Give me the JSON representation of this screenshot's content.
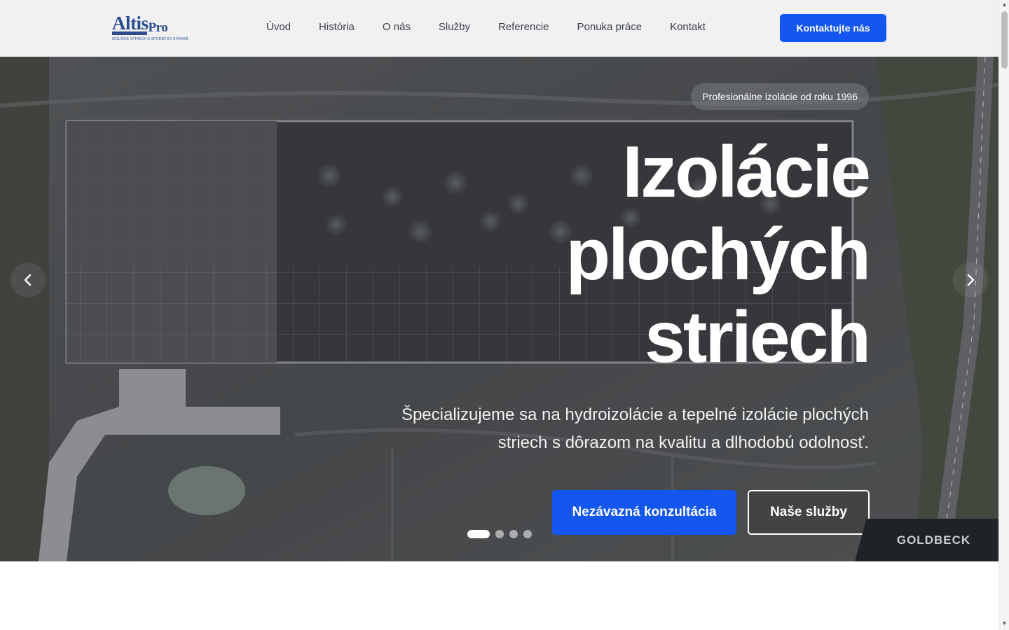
{
  "brand": {
    "logo_main": "AltisPro",
    "logo_main_a": "Altis",
    "logo_main_b": "Pro",
    "logo_tagline": "IZOLÁCIE STRIECH A SPODNÝCH STAVIEB"
  },
  "nav": {
    "items": [
      {
        "label": "Úvod"
      },
      {
        "label": "História"
      },
      {
        "label": "O nás"
      },
      {
        "label": "Služby"
      },
      {
        "label": "Referencie"
      },
      {
        "label": "Ponuka práce"
      },
      {
        "label": "Kontakt"
      }
    ],
    "cta_label": "Kontaktujte nás"
  },
  "hero": {
    "badge": "Profesionálne izolácie od roku 1996",
    "title_lines": [
      "Izolácie",
      "plochých",
      "striech"
    ],
    "text": "Špecializujeme sa na hydroizolácie a tepelné izolácie plochých striech s dôrazom na kvalitu a dlhodobú odolnosť.",
    "primary_button": "Nezávazná konzultácia",
    "secondary_button": "Naše služby",
    "slides_total": 4,
    "active_slide": 1,
    "watermark": "GOLDBECK"
  },
  "colors": {
    "accent": "#1456f0",
    "header_bg": "#f1f1f2",
    "logo": "#2c4e91"
  },
  "icons": {
    "prev": "chevron-left-icon",
    "next": "chevron-right-icon"
  }
}
